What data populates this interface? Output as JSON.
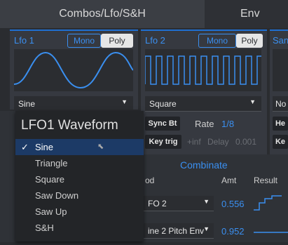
{
  "tabs": {
    "combos": "Combos/Lfo/S&H",
    "env": "Env"
  },
  "lfo1": {
    "title": "Lfo 1",
    "mono": "Mono",
    "poly": "Poly",
    "waveform": "Sine"
  },
  "lfo2": {
    "title": "Lfo 2",
    "mono": "Mono",
    "poly": "Poly",
    "waveform": "Square",
    "sync_label": "Sync Bt",
    "rate_label": "Rate",
    "rate_value": "1/8",
    "keytrig_label": "Key trig",
    "inf_label": "+inf",
    "delay_label": "Delay",
    "delay_value": "0.001"
  },
  "sh": {
    "title": "San",
    "row1": "No",
    "row2": "He",
    "row3": "Ke"
  },
  "combinate": {
    "title": "Combinate",
    "col_mod": "od",
    "col_amt": "Amt",
    "col_result": "Result",
    "rows": [
      {
        "source": "FO 2",
        "amt": "0.556"
      },
      {
        "source": "ine 2 Pitch Env",
        "amt": "0.952"
      }
    ]
  },
  "menu": {
    "title": "LFO1 Waveform",
    "check": "✓",
    "items": [
      "Sine",
      "Triangle",
      "Square",
      "Saw Down",
      "Saw Up",
      "S&H"
    ]
  },
  "colors": {
    "accent": "#3a8ff0",
    "selected_row": "#1c3a66"
  }
}
